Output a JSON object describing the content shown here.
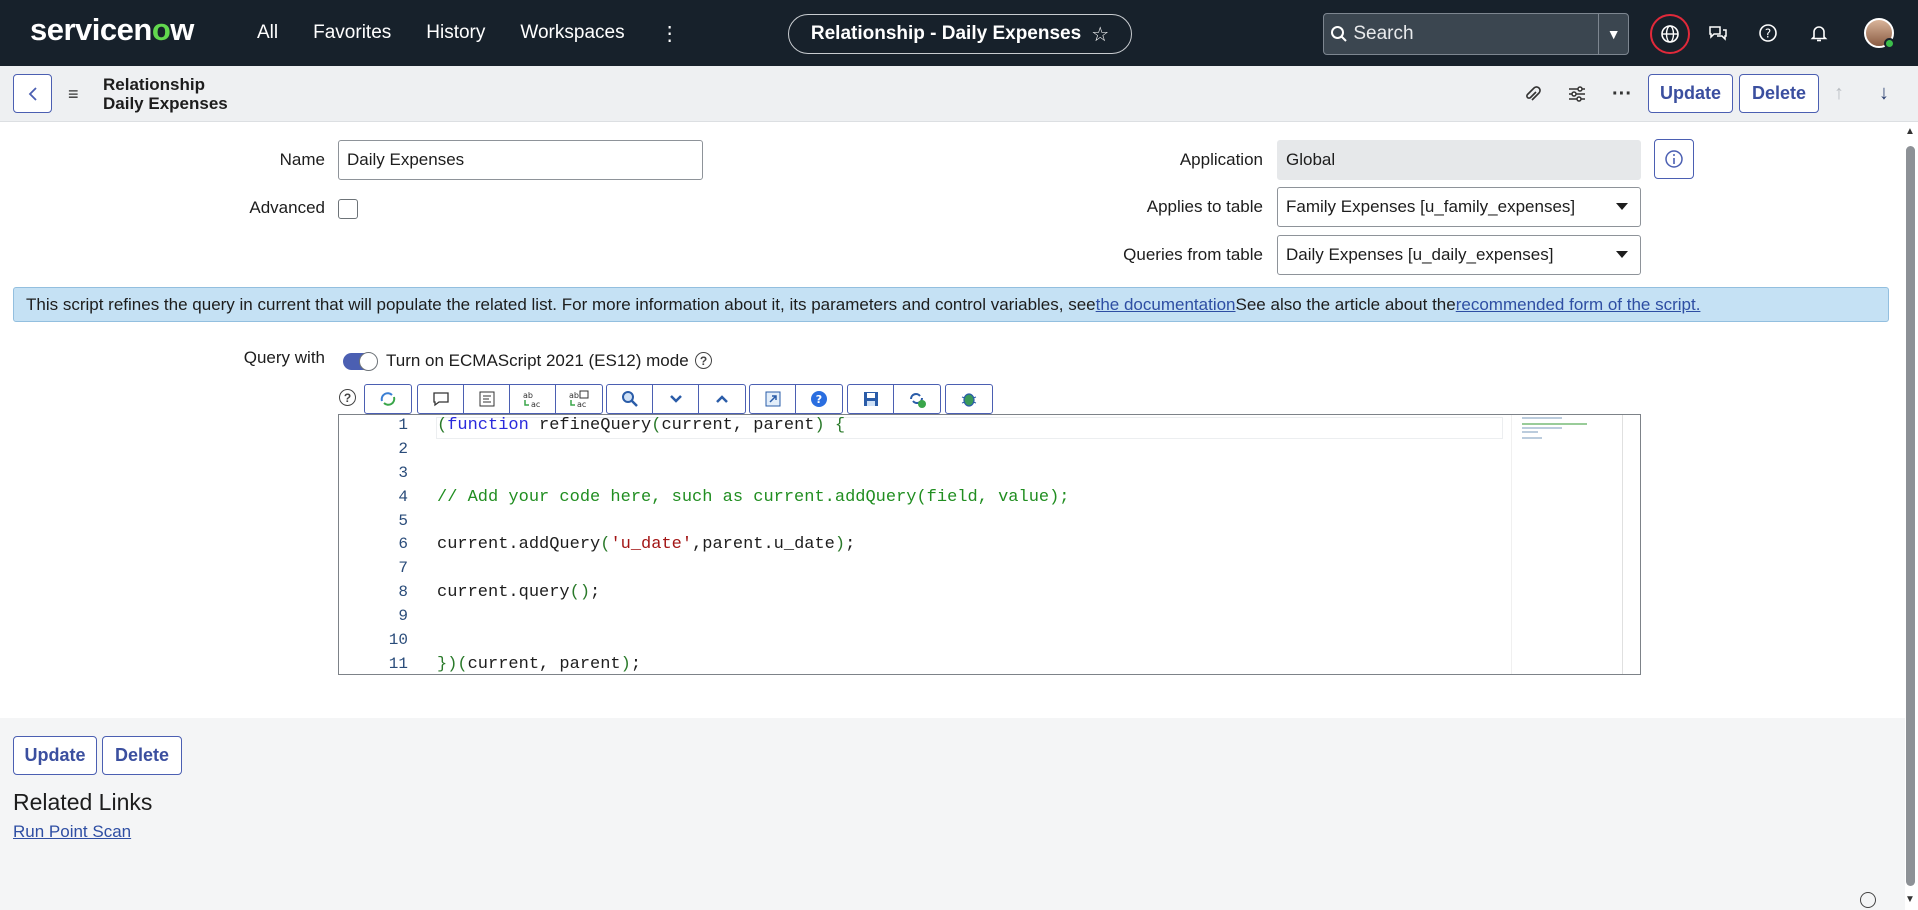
{
  "nav": {
    "logo": "servicenow",
    "links": [
      "All",
      "Favorites",
      "History",
      "Workspaces"
    ],
    "record_title": "Relationship - Daily Expenses",
    "search_placeholder": "Search"
  },
  "header": {
    "line1": "Relationship",
    "line2": "Daily Expenses",
    "update_label": "Update",
    "delete_label": "Delete"
  },
  "form": {
    "name_label": "Name",
    "name_value": "Daily Expenses",
    "advanced_label": "Advanced",
    "application_label": "Application",
    "application_value": "Global",
    "applies_label": "Applies to table",
    "applies_value": "Family Expenses [u_family_expenses]",
    "queries_label": "Queries from table",
    "queries_value": "Daily Expenses [u_daily_expenses]"
  },
  "banner": {
    "text1": "This script refines the query in current that will populate the related list. For more information about it, its parameters and control variables, see ",
    "link1": "the documentation",
    "text2": " See also the article about the ",
    "link2": "recommended form of the script."
  },
  "script": {
    "query_with_label": "Query with",
    "es_mode_label": "Turn on ECMAScript 2021 (ES12) mode",
    "line_numbers": [
      "1",
      "2",
      "3",
      "4",
      "5",
      "6",
      "7",
      "8",
      "9",
      "10",
      "11"
    ]
  },
  "footer": {
    "update_label": "Update",
    "delete_label": "Delete",
    "related_links": "Related Links",
    "run_point_scan": "Run Point Scan"
  }
}
